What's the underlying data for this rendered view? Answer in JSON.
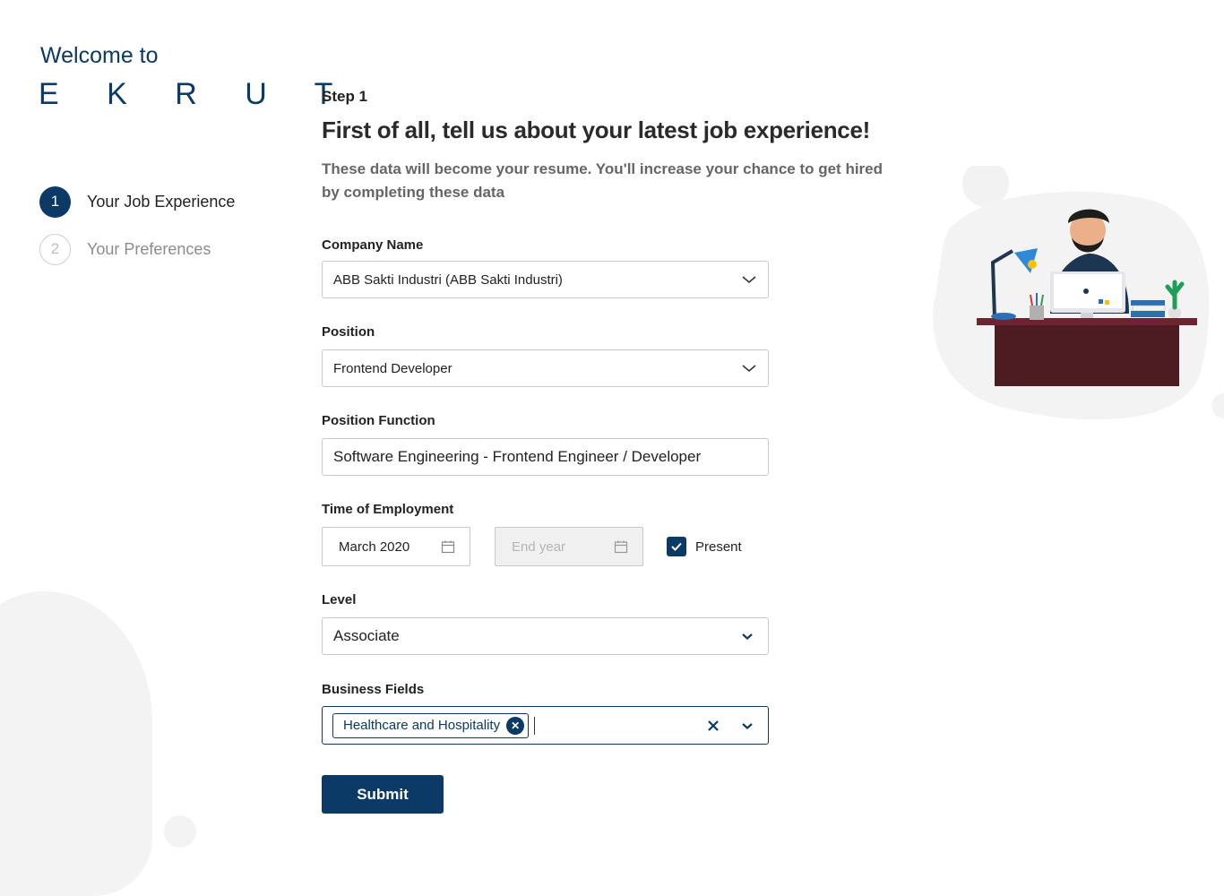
{
  "brand": {
    "welcome": "Welcome to",
    "logo": "E K R U T"
  },
  "steps": [
    {
      "number": "1",
      "label": "Your Job Experience",
      "state": "active"
    },
    {
      "number": "2",
      "label": "Your Preferences",
      "state": "inactive"
    }
  ],
  "form": {
    "step_caption": "Step 1",
    "headline": "First of all, tell us about your latest job experience!",
    "subtitle": "These data will become your resume. You'll increase your chance to get hired by completing these data",
    "company": {
      "label": "Company Name",
      "value": "ABB Sakti Industri (ABB Sakti Industri)"
    },
    "position": {
      "label": "Position",
      "value": "Frontend Developer"
    },
    "position_function": {
      "label": "Position Function",
      "value": "Software Engineering - Frontend Engineer / Developer"
    },
    "employment": {
      "label": "Time of Employment",
      "start_value": "March 2020",
      "end_placeholder": "End year",
      "present_label": "Present",
      "present_checked": true
    },
    "level": {
      "label": "Level",
      "value": "Associate"
    },
    "business_fields": {
      "label": "Business Fields",
      "tags": [
        "Healthcare and Hospitality"
      ]
    },
    "submit_label": "Submit"
  },
  "colors": {
    "primary": "#0b3a66",
    "border": "#c9c9c9",
    "blob": "#f3f3f3"
  }
}
